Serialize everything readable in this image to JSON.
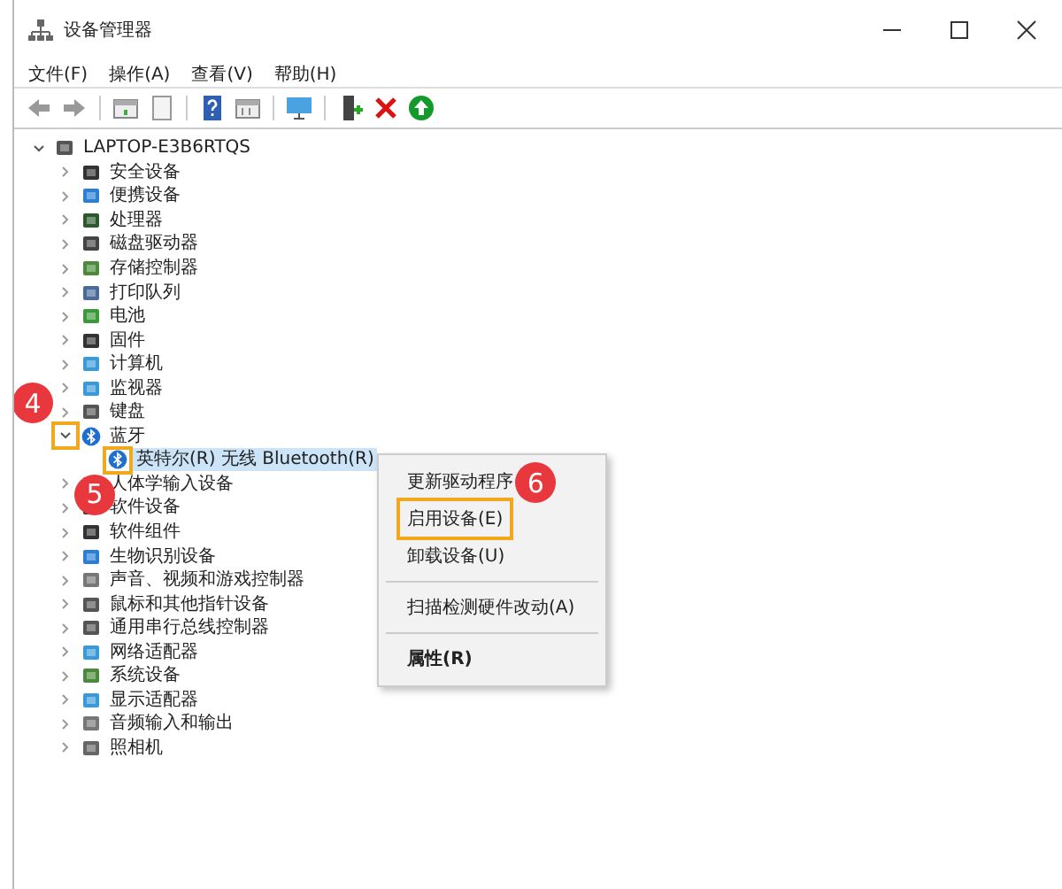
{
  "window": {
    "title": "设备管理器"
  },
  "menu": [
    "文件(F)",
    "操作(A)",
    "查看(V)",
    "帮助(H)"
  ],
  "toolbar": [
    {
      "kind": "back"
    },
    {
      "kind": "forward"
    },
    {
      "kind": "separator"
    },
    {
      "kind": "properties"
    },
    {
      "kind": "page"
    },
    {
      "kind": "separator"
    },
    {
      "kind": "help"
    },
    {
      "kind": "grid"
    },
    {
      "kind": "separator"
    },
    {
      "kind": "monitor"
    },
    {
      "kind": "separator"
    },
    {
      "kind": "enable"
    },
    {
      "kind": "remove"
    },
    {
      "kind": "update"
    }
  ],
  "tree": {
    "label": "LAPTOP-E3B6RTQS",
    "kind": "computer",
    "expanded": true,
    "selected": false,
    "children": [
      {
        "label": "安全设备",
        "kind": "security",
        "expanded": false,
        "selected": false
      },
      {
        "label": "便携设备",
        "kind": "portable",
        "expanded": false,
        "selected": false
      },
      {
        "label": "处理器",
        "kind": "chip",
        "expanded": false,
        "selected": false
      },
      {
        "label": "磁盘驱动器",
        "kind": "disk",
        "expanded": false,
        "selected": false
      },
      {
        "label": "存储控制器",
        "kind": "storage",
        "expanded": false,
        "selected": false
      },
      {
        "label": "打印队列",
        "kind": "printer",
        "expanded": false,
        "selected": false
      },
      {
        "label": "电池",
        "kind": "battery",
        "expanded": false,
        "selected": false
      },
      {
        "label": "固件",
        "kind": "firmware",
        "expanded": false,
        "selected": false
      },
      {
        "label": "计算机",
        "kind": "monitor",
        "expanded": false,
        "selected": false
      },
      {
        "label": "监视器",
        "kind": "monitor",
        "expanded": false,
        "selected": false
      },
      {
        "label": "键盘",
        "kind": "keyboard",
        "expanded": false,
        "selected": false
      },
      {
        "label": "蓝牙",
        "kind": "bluetooth",
        "expanded": true,
        "selected": false,
        "toggle_outlined": true,
        "step": "4",
        "children": [
          {
            "label": "英特尔(R) 无线 Bluetooth(R)",
            "kind": "bluetooth-device",
            "selected": true,
            "icon_outlined": true,
            "step": "5"
          }
        ]
      },
      {
        "label": "人体学输入设备",
        "kind": "keyboard",
        "expanded": false,
        "selected": false
      },
      {
        "label": "软件设备",
        "kind": "firmware",
        "expanded": false,
        "selected": false
      },
      {
        "label": "软件组件",
        "kind": "firmware",
        "expanded": false,
        "selected": false
      },
      {
        "label": "生物识别设备",
        "kind": "portable",
        "expanded": false,
        "selected": false
      },
      {
        "label": "声音、视频和游戏控制器",
        "kind": "speaker",
        "expanded": false,
        "selected": false
      },
      {
        "label": "鼠标和其他指针设备",
        "kind": "mouse",
        "expanded": false,
        "selected": false
      },
      {
        "label": "通用串行总线控制器",
        "kind": "usb",
        "expanded": false,
        "selected": false
      },
      {
        "label": "网络适配器",
        "kind": "monitor",
        "expanded": false,
        "selected": false
      },
      {
        "label": "系统设备",
        "kind": "storage",
        "expanded": false,
        "selected": false
      },
      {
        "label": "显示适配器",
        "kind": "monitor",
        "expanded": false,
        "selected": false
      },
      {
        "label": "音频输入和输出",
        "kind": "speaker",
        "expanded": false,
        "selected": false
      },
      {
        "label": "照相机",
        "kind": "camera",
        "expanded": false,
        "selected": false
      }
    ]
  },
  "context_menu": [
    {
      "kind": "item",
      "label": "更新驱动程序",
      "bold": false,
      "outlined": false
    },
    {
      "kind": "item",
      "label": "启用设备(E)",
      "bold": false,
      "outlined": true,
      "step": "6"
    },
    {
      "kind": "item",
      "label": "卸载设备(U)",
      "bold": false,
      "outlined": false
    },
    {
      "kind": "separator"
    },
    {
      "kind": "item",
      "label": "扫描检测硬件改动(A)",
      "bold": false,
      "outlined": false
    },
    {
      "kind": "separator"
    },
    {
      "kind": "item",
      "label": "属性(R)",
      "bold": true,
      "outlined": false
    }
  ]
}
